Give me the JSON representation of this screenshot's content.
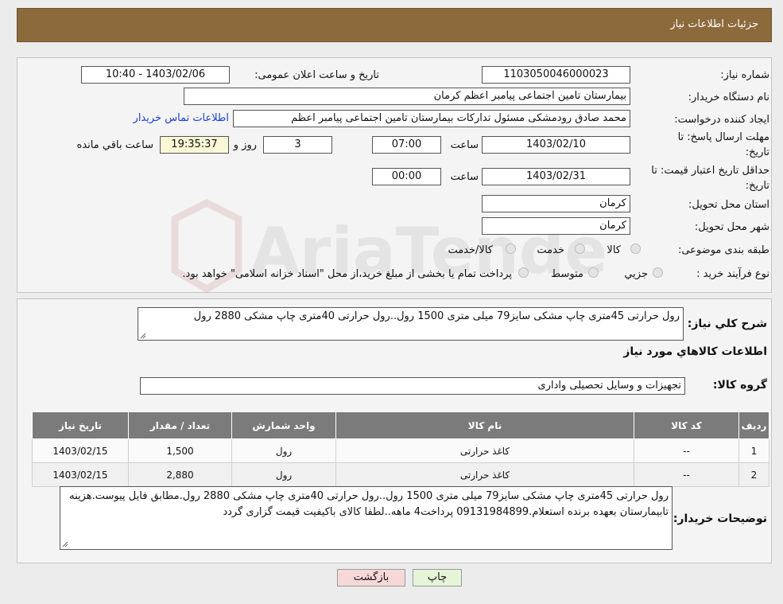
{
  "header": {
    "title": "جزئیات اطلاعات نیاز"
  },
  "need": {
    "number_label": "شماره نیاز:",
    "number": "1103050046000023",
    "announce_label": "تاریخ و ساعت اعلان عمومی:",
    "announce_value": "1403/02/06 - 10:40",
    "buyer_org_label": "نام دستگاه خریدار:",
    "buyer_org": "بیمارستان تامین اجتماعی پیامبر اعظم کرمان",
    "creator_label": "ایجاد کننده درخواست:",
    "creator": "محمد صادق  رودمشکی مسئول تدارکات بیمارستان تامین اجتماعی پیامبر اعظم",
    "contact_link": "اطلاعات تماس خریدار",
    "deadline_label_1": "مهلت ارسال پاسخ: تا",
    "deadline_label_2": "تاریخ:",
    "deadline_date": "1403/02/10",
    "time_label": "ساعت",
    "deadline_time": "07:00",
    "days_value": "3",
    "days_label": "روز و",
    "remaining_time": "19:35:37",
    "remaining_label": "ساعت باقي مانده",
    "validity_label_1": "حداقل تاریخ اعتبار قیمت: تا",
    "validity_label_2": "تاریخ:",
    "validity_date": "1403/02/31",
    "validity_time": "00:00",
    "province_label": "استان محل تحویل:",
    "province": "کرمان",
    "city_label": "شهر محل تحویل:",
    "city": "کرمان",
    "category_label": "طبقه بندی موضوعی:",
    "category_options": [
      "کالا",
      "خدمت",
      "کالا/خدمت"
    ],
    "process_label": "نوع فرآیند خرید :",
    "process_options": [
      "جزیي",
      "متوسط"
    ],
    "process_note": "پرداخت تمام یا بخشی از مبلغ خرید،از محل \"اسناد خزانه اسلامی\" خواهد بود."
  },
  "summary": {
    "label": "شرح کلي نياز:",
    "text": "رول حرارتی 45متری  چاپ مشکی سایز79 میلی متری 1500 رول..رول حرارتی 40متری چاپ مشکی 2880 رول"
  },
  "goods": {
    "section_title": "اطلاعات کالاهاي مورد نياز",
    "group_label": "گروه کالا:",
    "group_value": "تجهیزات و وسایل تحصیلی واداری",
    "columns": [
      "رديف",
      "کد کالا",
      "نام کالا",
      "واحد شمارش",
      "تعداد / مقدار",
      "تاريخ نياز"
    ],
    "rows": [
      [
        "1",
        "--",
        "کاغذ حرارتی",
        "رول",
        "1,500",
        "1403/02/15"
      ],
      [
        "2",
        "--",
        "کاغذ حرارتی",
        "رول",
        "2,880",
        "1403/02/15"
      ]
    ]
  },
  "buyer_notes": {
    "label": "توضیحات خریدار:",
    "text": "رول حرارتی 45متری  چاپ مشکی سایز79 میلی متری 1500 رول..رول حرارتی 40متری چاپ مشکی 2880 رول.مطابق فایل پیوست.هزینه تابیمارستان بعهده برنده استعلام.09131984899 پرداخت4 ماهه..لطفا کالای باکیفیت قیمت گزاری گردد"
  },
  "buttons": {
    "print": "چاپ",
    "back": "بازگشت"
  },
  "watermark": {
    "text": "AriaTender.neT"
  },
  "colors": {
    "header": "#8c6a3c",
    "table_header": "#7b7b7b",
    "print_btn": "#e6f5d8",
    "back_btn": "#f7d8d8",
    "link": "#1a3fd1"
  }
}
